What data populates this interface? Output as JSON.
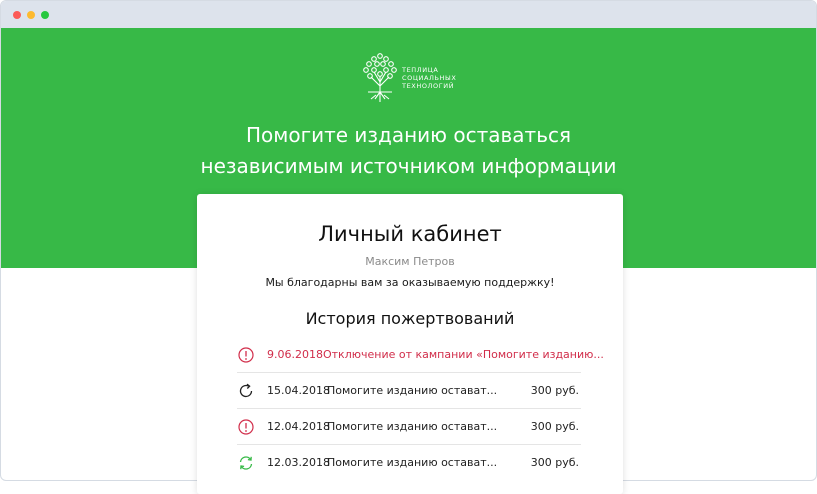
{
  "brand": {
    "logo_lines": [
      "ТЕПЛИЦА",
      "СОЦИАЛЬНЫХ",
      "ТЕХНОЛОГИЙ"
    ],
    "logo_icon": "tree-icon"
  },
  "hero": {
    "headline_line1": "Помогите изданию оставаться",
    "headline_line2": "независимым источником информации"
  },
  "account": {
    "title": "Личный кабинет",
    "user_name": "Максим Петров",
    "thanks": "Мы благодарны вам за оказываемую поддержку!"
  },
  "history": {
    "title": "История пожертвований",
    "items": [
      {
        "icon": "alert-circle-icon",
        "date": "9.06.2018",
        "description": "Отключение от кампании «Помогите изданию...",
        "amount": ""
      },
      {
        "icon": "refresh-icon",
        "date": "15.04.2018",
        "description": "Помогите изданию остават...",
        "amount": "300 руб."
      },
      {
        "icon": "alert-circle-icon",
        "date": "12.04.2018",
        "description": "Помогите изданию остават...",
        "amount": "300 руб."
      },
      {
        "icon": "recurring-icon",
        "date": "12.03.2018",
        "description": "Помогите изданию остават...",
        "amount": "300 руб."
      }
    ]
  },
  "colors": {
    "brand_green": "#37b947",
    "alert_red": "#d12d4a",
    "success_green": "#37b947"
  }
}
